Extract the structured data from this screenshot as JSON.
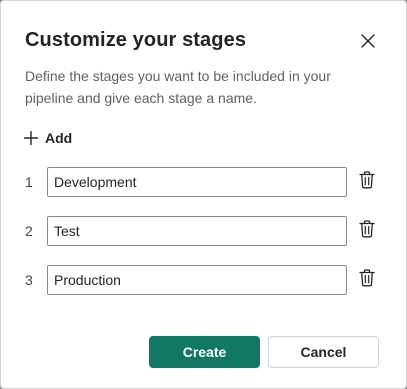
{
  "dialog": {
    "title": "Customize your stages",
    "description": "Define the stages you want to be included in your pipeline and give each stage a name.",
    "close_icon": "close-icon"
  },
  "add": {
    "label": "Add",
    "icon": "plus-icon"
  },
  "stages": [
    {
      "number": "1",
      "value": "Development"
    },
    {
      "number": "2",
      "value": "Test"
    },
    {
      "number": "3",
      "value": "Production"
    }
  ],
  "stage_delete_icon": "trash-icon",
  "buttons": {
    "create_label": "Create",
    "cancel_label": "Cancel"
  },
  "colors": {
    "primary": "#117865",
    "text": "#242424",
    "muted": "#616161"
  }
}
